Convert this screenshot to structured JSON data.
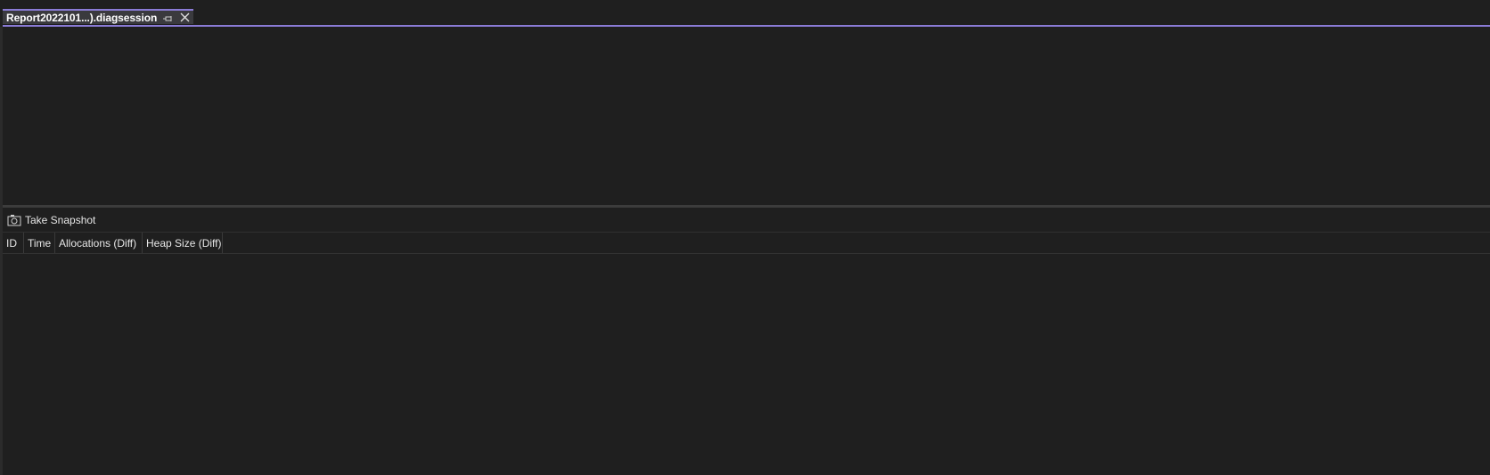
{
  "document_tab": {
    "title": "Report2022101...).diagsession",
    "pin_icon": "pin-icon",
    "close_icon": "close-icon"
  },
  "toolbar": {
    "take_snapshot_label": "Take Snapshot",
    "take_snapshot_icon": "camera-icon"
  },
  "table": {
    "columns": [
      {
        "label": "ID"
      },
      {
        "label": "Time"
      },
      {
        "label": "Allocations (Diff)"
      },
      {
        "label": "Heap Size (Diff)"
      }
    ],
    "rows": []
  },
  "colors": {
    "accent": "#8a7bd6",
    "background": "#1f1f1f",
    "tab_background": "#3a3a3e"
  }
}
